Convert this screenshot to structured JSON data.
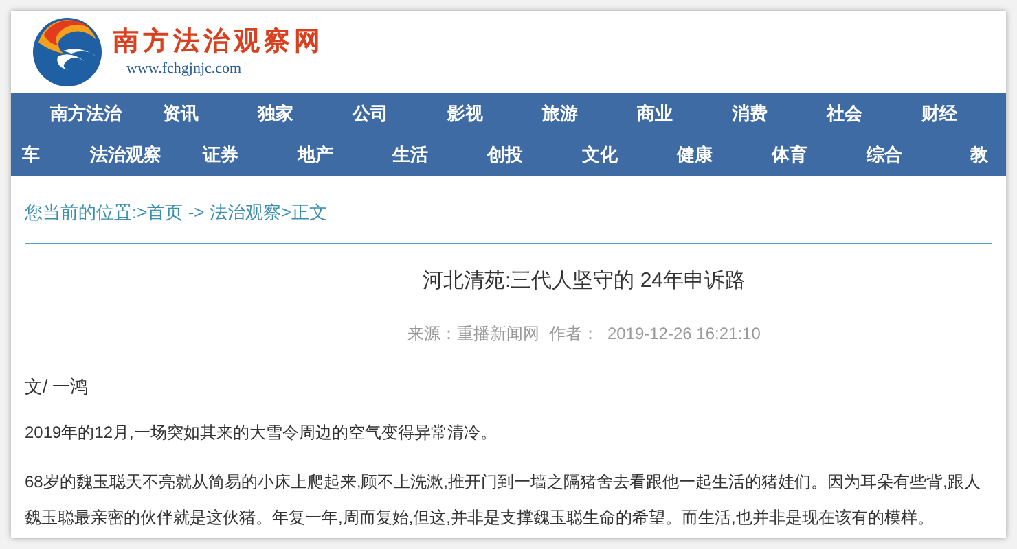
{
  "header": {
    "site_name": "南方法治观察网",
    "site_url": "www.fchgjnjc.com"
  },
  "nav": {
    "rows": [
      [
        "南方法治",
        "资讯",
        "独家",
        "公司",
        "影视",
        "旅游",
        "商业",
        "消费",
        "社会",
        "财经"
      ],
      [
        "车",
        "法治观察",
        "证券",
        "地产",
        "生活",
        "创投",
        "文化",
        "健康",
        "体育",
        "综合",
        "教"
      ]
    ]
  },
  "breadcrumb": "您当前的位置:>首页 -> 法治观察>正文",
  "article": {
    "title": "河北清苑:三代人坚守的 24年申诉路",
    "meta": "来源：重播新闻网  作者：  2019-12-26 16:21:10",
    "byline": "文/ 一鸿",
    "paragraphs": [
      [
        "2019年的12月,一场突如其来的大雪令周边的空气变得异常清冷。"
      ],
      [
        "68岁的魏玉聪天不亮就从简易的小床上爬起来,顾不上洗漱,推开门到一墙之隔猪舍去看跟他一起生活的猪娃们。因为耳朵有些背,跟人",
        "魏玉聪最亲密的伙伴就是这伙猪。年复一年,周而复始,但这,并非是支撑魏玉聪生命的希望。而生活,也并非是现在该有的模样。"
      ]
    ]
  }
}
